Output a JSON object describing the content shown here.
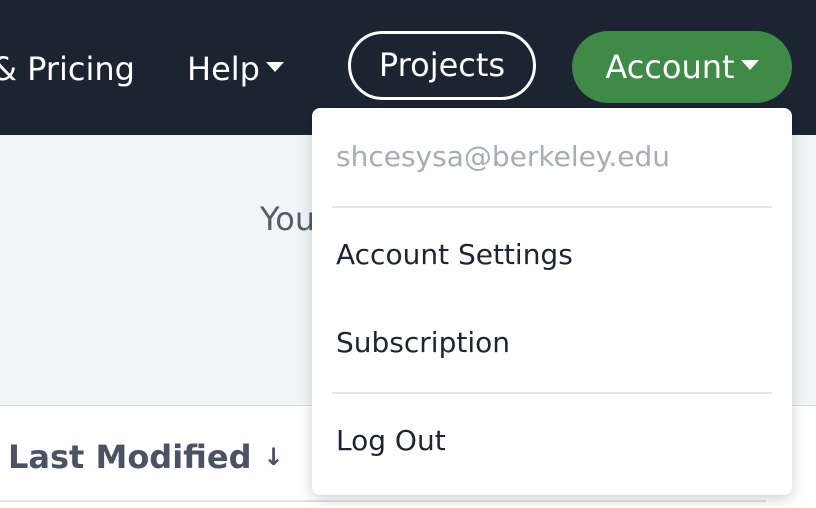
{
  "navbar": {
    "pricing_label": "& Pricing",
    "help_label": "Help",
    "projects_label": "Projects",
    "account_label": "Account"
  },
  "main": {
    "partial_text": "You"
  },
  "table": {
    "column_header": "Last Modified",
    "sort_icon": "arrow-down-icon"
  },
  "account_menu": {
    "email": "shcesysa@berkeley.edu",
    "items": [
      {
        "label": "Account Settings"
      },
      {
        "label": "Subscription"
      },
      {
        "label": "Log Out"
      }
    ]
  },
  "colors": {
    "navbar_bg": "#1c2331",
    "account_button": "#3e8a46"
  }
}
